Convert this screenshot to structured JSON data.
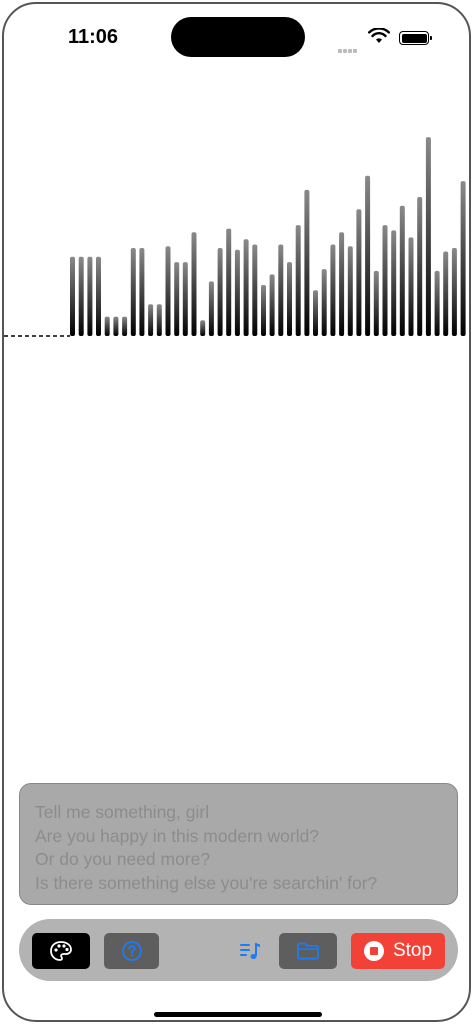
{
  "status_bar": {
    "time": "11:06",
    "icons": [
      "cellular-signal-icon",
      "wifi-icon",
      "battery-icon"
    ]
  },
  "waveform": {
    "bar_levels": [
      0.45,
      0.45,
      0.45,
      0.45,
      0.11,
      0.11,
      0.11,
      0.5,
      0.5,
      0.18,
      0.18,
      0.51,
      0.42,
      0.42,
      0.59,
      0.09,
      0.31,
      0.5,
      0.61,
      0.49,
      0.55,
      0.52,
      0.29,
      0.35,
      0.52,
      0.42,
      0.63,
      0.83,
      0.26,
      0.38,
      0.52,
      0.59,
      0.51,
      0.72,
      0.91,
      0.37,
      0.63,
      0.6,
      0.74,
      0.56,
      0.79,
      1.13,
      0.37,
      0.48,
      0.5,
      0.88
    ],
    "colors": {
      "bar_top": "#8a8a8a",
      "bar_bottom": "#000000",
      "baseline": "#000000"
    }
  },
  "lyrics": {
    "lines": [
      "Tell me something, girl",
      "Are you happy in this modern world?",
      "Or do you need more?",
      "Is there something else you're searchin' for?"
    ]
  },
  "toolbar": {
    "palette_icon": "palette-icon",
    "help_icon": "question-circle-icon",
    "playlist_icon": "music-list-icon",
    "folder_icon": "folder-icon",
    "stop_label": "Stop",
    "colors": {
      "accent_blue": "#1e7cf2",
      "stop_red": "#f24238"
    }
  }
}
